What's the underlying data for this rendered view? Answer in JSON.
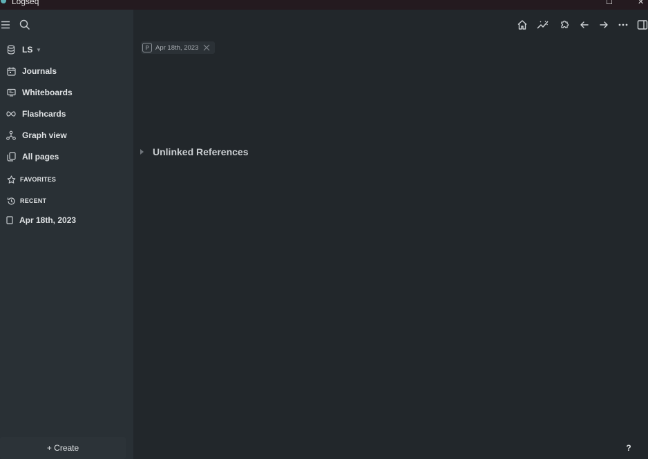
{
  "window": {
    "title": "Logseq",
    "maximize_glyph": "☐",
    "close_glyph": "✕"
  },
  "sidebar": {
    "graph_name": "LS",
    "nav": [
      {
        "label": "Journals",
        "icon": "calendar-icon"
      },
      {
        "label": "Whiteboards",
        "icon": "whiteboard-icon"
      },
      {
        "label": "Flashcards",
        "icon": "infinity-icon"
      },
      {
        "label": "Graph view",
        "icon": "graph-icon"
      },
      {
        "label": "All pages",
        "icon": "pages-icon"
      }
    ],
    "favorites_label": "FAVORITES",
    "recent_label": "RECENT",
    "recent_pages": [
      {
        "label": "Apr 18th, 2023",
        "icon": "page-icon"
      }
    ],
    "create_label": "+ Create"
  },
  "toolbar": {
    "buttons": [
      "home-icon",
      "chart-icon",
      "puzzle-icon",
      "arrow-left-icon",
      "arrow-right-icon",
      "more-icon",
      "sidebar-toggle-icon"
    ]
  },
  "main": {
    "page_badge": "P",
    "page_tag": "Apr 18th, 2023",
    "unlinked_references": "Unlinked References"
  },
  "help": {
    "label": "?"
  },
  "colors": {
    "sidebar_bg": "#293035",
    "main_bg": "#22272b",
    "titlebar_bg": "#241a1f",
    "text": "#dfe2e4",
    "muted": "#8b9197"
  }
}
